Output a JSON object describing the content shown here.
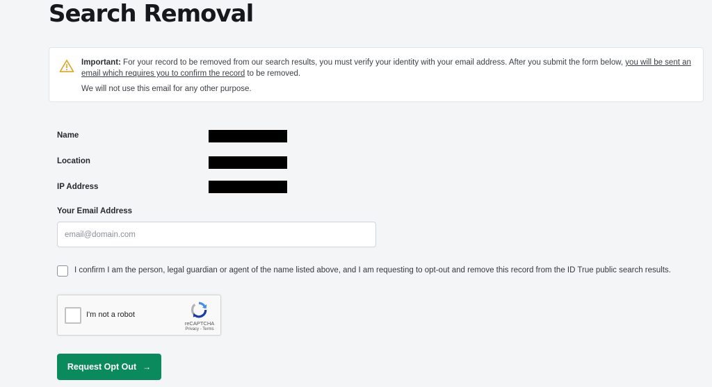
{
  "page": {
    "title": "Search Removal"
  },
  "notice": {
    "important_label": "Important:",
    "text_before_link": " For your record to be removed from our search results, you must verify your identity with your email address. After you submit the form below, ",
    "link_text": "you will be sent an email which requires you to confirm the record",
    "text_after_link": " to be removed.",
    "sub_text": "We will not use this email for any other purpose."
  },
  "record": {
    "name_label": "Name",
    "location_label": "Location",
    "ip_label": "IP Address"
  },
  "email": {
    "label": "Your Email Address",
    "placeholder": "email@domain.com",
    "value": ""
  },
  "confirm": {
    "text": "I confirm I am the person, legal guardian or agent of the name listed above, and I am requesting to opt-out and remove this record from the ID True public search results."
  },
  "recaptcha": {
    "label": "I'm not a robot",
    "brand": "reCAPTCHA",
    "links": "Privacy - Terms"
  },
  "submit": {
    "label": "Request Opt Out",
    "arrow": "→"
  },
  "colors": {
    "accent": "#0b8a5e",
    "warning": "#e0a526"
  }
}
